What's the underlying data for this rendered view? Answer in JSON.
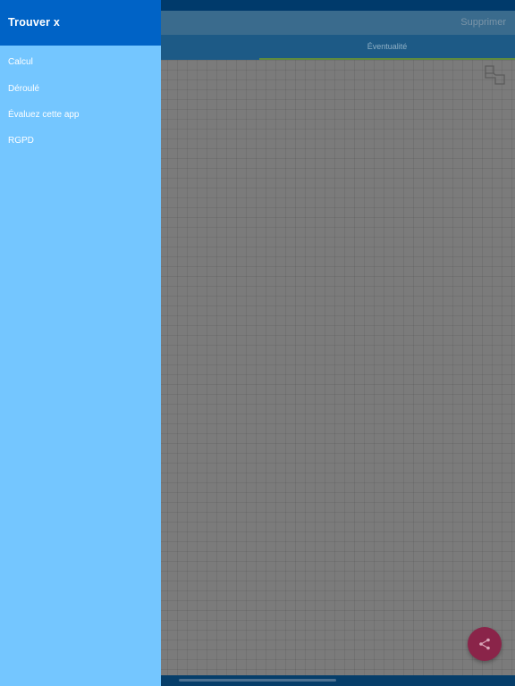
{
  "header": {
    "delete_label": "Supprimer"
  },
  "tabs": [
    {
      "label": "Éventualité",
      "active": true
    }
  ],
  "drawer": {
    "title": "Trouver x",
    "items": [
      {
        "label": "Calcul"
      },
      {
        "label": "Déroulé"
      },
      {
        "label": "Évaluez cette app"
      },
      {
        "label": "RGPD"
      }
    ]
  },
  "icons": {
    "copy": "copy-icon",
    "share": "share-icon"
  },
  "colors": {
    "drawer_header": "#0063c6",
    "drawer_background": "#74c6ff",
    "fab": "#8a2449",
    "tab_indicator": "#5e8b3e"
  }
}
